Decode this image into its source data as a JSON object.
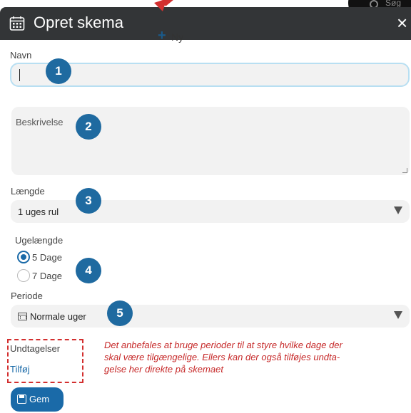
{
  "background": {
    "search_text": "Søg",
    "new_label": "Ny"
  },
  "modal": {
    "title": "Opret skema",
    "close_glyph": "×"
  },
  "form": {
    "name_label": "Navn",
    "name_value": "",
    "description_placeholder": "Beskrivelse",
    "length_label": "Længde",
    "length_value": "1 uges rul",
    "week_length_label": "Ugelængde",
    "week_options": [
      {
        "label": "5 Dage",
        "selected": true
      },
      {
        "label": "7 Dage",
        "selected": false
      }
    ],
    "period_label": "Periode",
    "period_value": "Normale uger",
    "exceptions_label": "Undtagelser",
    "add_link": "Tilføj",
    "save_label": "Gem"
  },
  "annotations": {
    "badges": [
      "1",
      "2",
      "3",
      "4",
      "5"
    ],
    "note_lines": [
      "Det anbefales at bruge perioder til at styre hvilke dage der",
      "skal være tilgængelige. Ellers kan der også tilføjes undta-",
      "gelse her direkte på skemaet"
    ]
  },
  "colors": {
    "header_bg": "#333537",
    "primary": "#1a6aa8",
    "badge": "#1f6aa0",
    "annotation_red": "#d32f2f",
    "field_bg": "#f2f2f2"
  }
}
